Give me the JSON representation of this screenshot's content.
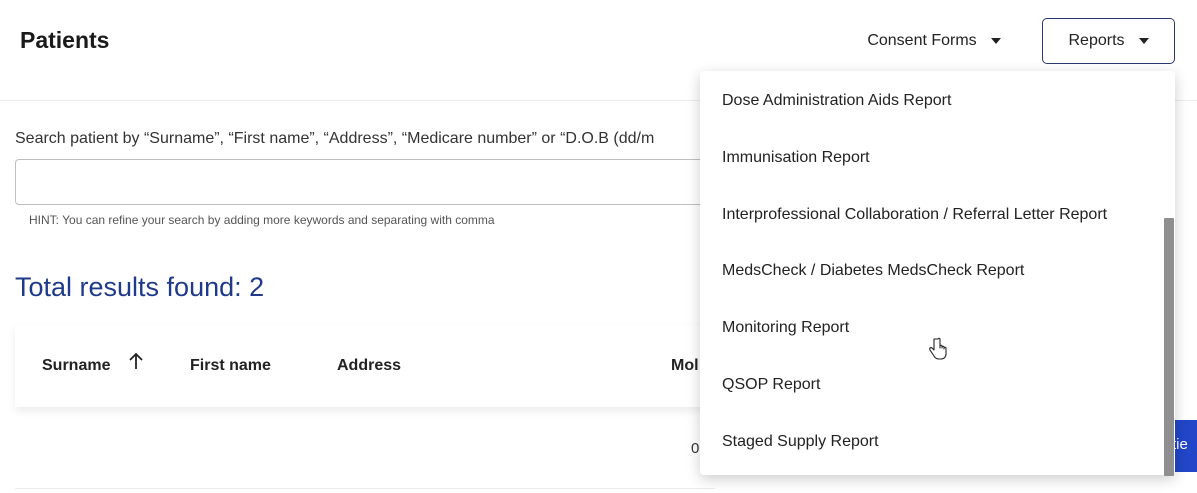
{
  "header": {
    "title": "Patients",
    "consent_forms_label": "Consent Forms",
    "reports_label": "Reports"
  },
  "search": {
    "label": "Search patient by “Surname”, “First name”, “Address”, “Medicare number” or “D.O.B (dd/m",
    "hint": "HINT: You can refine your search by adding more keywords and separating with comma"
  },
  "results": {
    "count_text": "Total results found: 2"
  },
  "table": {
    "columns": [
      "Surname",
      "First name",
      "Address",
      "Mol"
    ],
    "row_fragment": "0"
  },
  "action_button_fragment": "tie",
  "reports_menu": {
    "items": [
      "Dose Administration Aids Report",
      "Immunisation Report",
      "Interprofessional Collaboration / Referral Letter Report",
      "MedsCheck / Diabetes MedsCheck Report",
      "Monitoring Report",
      "QSOP Report",
      "Staged Supply Report"
    ]
  },
  "icons": {
    "sort": "arrow-up-icon",
    "dropdown": "caret-down-icon",
    "cursor": "hand-pointer-icon"
  }
}
